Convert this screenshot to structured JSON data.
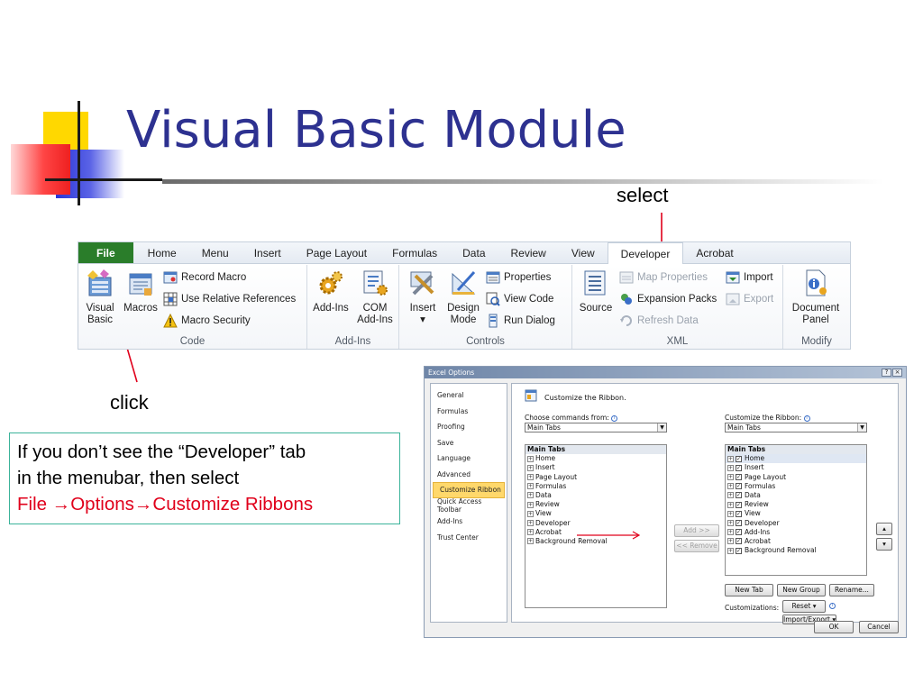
{
  "slide": {
    "title": "Visual Basic Module",
    "note_select": "select",
    "note_click": "click"
  },
  "infobox": {
    "line1": "If you don’t see the “Developer” tab",
    "line2": "in the menubar, then select",
    "line3_part1": "File ",
    "arrow1": "→",
    "line3_part2": "Options",
    "arrow2": "→",
    "line3_part3": "Customize Ribbons"
  },
  "ribbon": {
    "tabs": [
      "File",
      "Home",
      "Menu",
      "Insert",
      "Page Layout",
      "Formulas",
      "Data",
      "Review",
      "View",
      "Developer",
      "Acrobat"
    ],
    "active_tab": "Developer",
    "groups": {
      "code": {
        "label": "Code",
        "visual_basic": "Visual\nBasic",
        "macros": "Macros",
        "record_macro": "Record Macro",
        "use_relative": "Use Relative References",
        "macro_security": "Macro Security"
      },
      "addins": {
        "label": "Add-Ins",
        "addins": "Add-Ins",
        "com_addins_1": "COM",
        "com_addins_2": "Add-Ins"
      },
      "controls": {
        "label": "Controls",
        "insert": "Insert",
        "insert_caret": "▾",
        "design_mode_1": "Design",
        "design_mode_2": "Mode",
        "properties": "Properties",
        "view_code": "View Code",
        "run_dialog": "Run Dialog"
      },
      "xml": {
        "label": "XML",
        "source": "Source",
        "map_properties": "Map Properties",
        "expansion_packs": "Expansion Packs",
        "refresh_data": "Refresh Data",
        "import": "Import",
        "export": "Export"
      },
      "modify": {
        "label": "Modify",
        "document_panel_1": "Document",
        "document_panel_2": "Panel"
      }
    }
  },
  "dialog": {
    "title": "Excel Options",
    "title_buttons": [
      "?",
      "×"
    ],
    "nav_items": [
      "General",
      "Formulas",
      "Proofing",
      "Save",
      "Language",
      "Advanced",
      "Customize Ribbon",
      "Quick Access Toolbar",
      "Add-Ins",
      "Trust Center"
    ],
    "selected_nav": "Customize Ribbon",
    "heading": "Customize the Ribbon.",
    "choose_label": "Choose commands from:",
    "choose_value": "Main Tabs",
    "customize_label": "Customize the Ribbon:",
    "customize_value": "Main Tabs",
    "left_list": {
      "header": "Main Tabs",
      "items": [
        "Home",
        "Insert",
        "Page Layout",
        "Formulas",
        "Data",
        "Review",
        "View",
        "Developer",
        "Acrobat",
        "Background Removal"
      ]
    },
    "right_list": {
      "header": "Main Tabs",
      "items": [
        "Home",
        "Insert",
        "Page Layout",
        "Formulas",
        "Data",
        "Review",
        "View",
        "Developer",
        "Add-Ins",
        "Acrobat",
        "Background Removal"
      ]
    },
    "add_button": "Add >>",
    "remove_button": "<< Remove",
    "new_tab": "New Tab",
    "new_group": "New Group",
    "rename": "Rename...",
    "customizations_label": "Customizations:",
    "reset": "Reset ▾",
    "import_export": "Import/Export ▾",
    "ok": "OK",
    "cancel": "Cancel",
    "up_glyph": "▴",
    "down_glyph": "▾"
  },
  "colors": {
    "title_blue": "#2d3190",
    "arrow_red": "#e0001b",
    "file_tab_green": "#2a7d2a"
  }
}
